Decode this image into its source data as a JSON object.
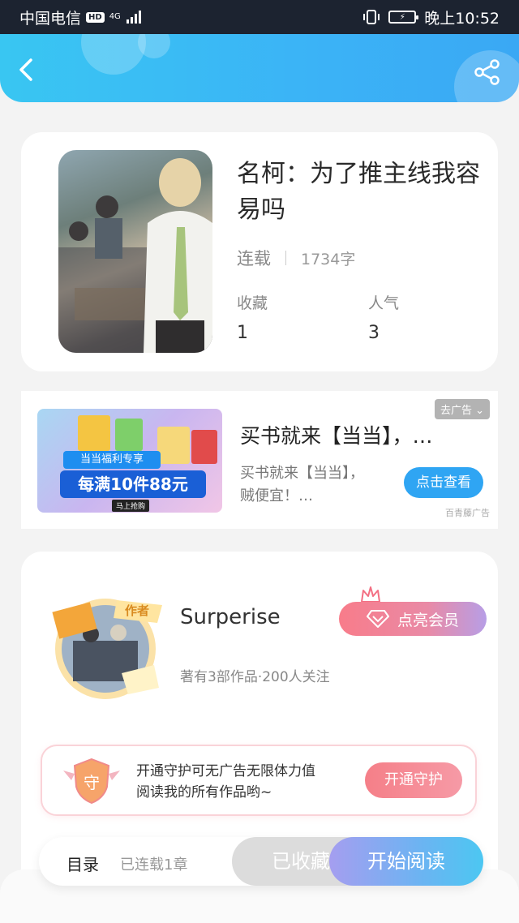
{
  "status_bar": {
    "carrier": "中国电信",
    "hd": "HD",
    "network": "4G",
    "time": "晚上10:52"
  },
  "book": {
    "title": "名柯：为了推主线我容易吗",
    "status": "连载",
    "word_count": "1734字",
    "stats": [
      {
        "label": "收藏",
        "value": "1"
      },
      {
        "label": "人气",
        "value": "3"
      }
    ]
  },
  "ad": {
    "image_banner": "当当福利专享",
    "image_promo": "每满10件88元",
    "image_button": "马上抢购",
    "title": "买书就来【当当】，…",
    "description": "买书就来【当当】，贼便宜！…",
    "remove_label": "去广告",
    "cta": "点击查看",
    "source": "百青藤广告"
  },
  "author": {
    "badge": "作者",
    "name": "Surperise",
    "meta": "著有3部作品·200人关注",
    "member_button": "点亮会员"
  },
  "guard": {
    "icon_text": "守",
    "line1": "开通守护可无广告无限体力值",
    "line2": "阅读我的所有作品哟~",
    "button": "开通守护"
  },
  "bottom_bar": {
    "toc": "目录",
    "toc_sub": "已连载1章",
    "collected": "已收藏",
    "read": "开始阅读"
  }
}
